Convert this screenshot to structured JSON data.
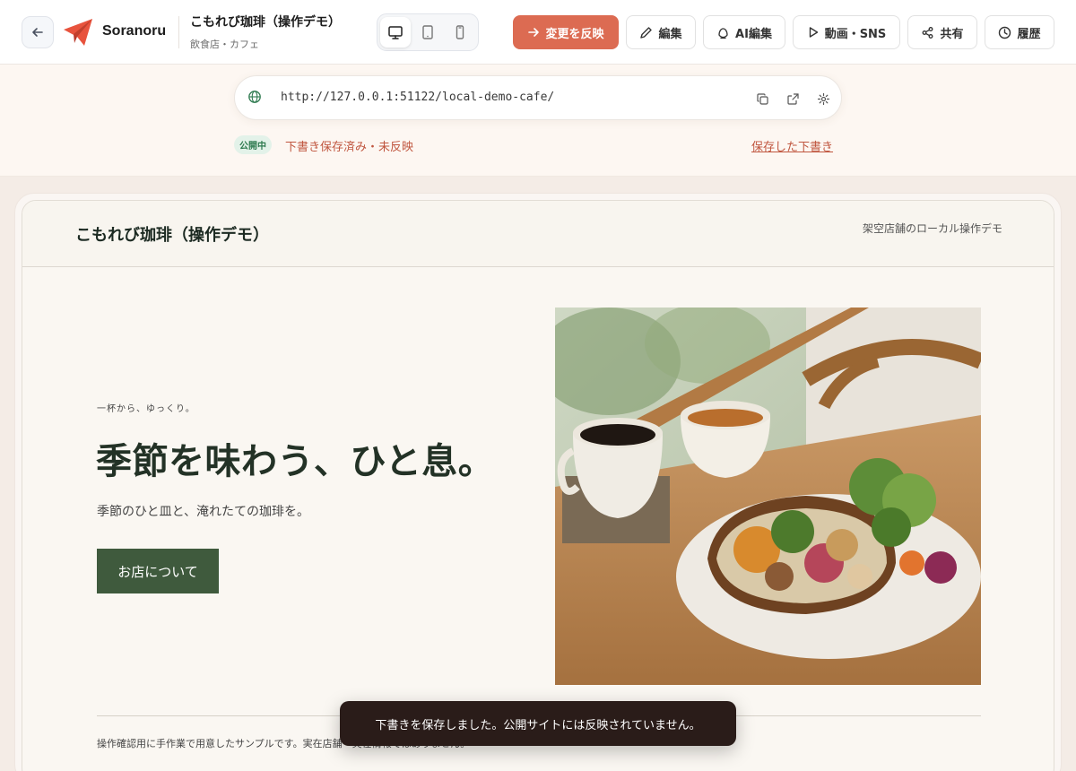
{
  "header": {
    "brand": "Soranoru",
    "site_title": "こもれび珈琲（操作デモ）",
    "site_category": "飲食店・カフェ",
    "actions": {
      "publish": "変更を反映",
      "edit": "編集",
      "ai_edit": "AI編集",
      "video_sns": "動画・SNS",
      "share": "共有",
      "history": "履歴"
    },
    "accent_color": "#dc6b52"
  },
  "preview": {
    "url": "http://127.0.0.1:51122/local-demo-cafe/",
    "status_badge": "公開中",
    "status_text": "下書き保存済み・未反映",
    "saved_draft_link": "保存した下書き"
  },
  "site": {
    "logo_text": "こもれび珈琲（操作デモ）",
    "tagline": "架空店舗のローカル操作デモ",
    "hero": {
      "eyebrow": "一杯から、ゆっくり。",
      "title": "季節を味わう、ひと息。",
      "description": "季節のひと皿と、淹れたての珈琲を。",
      "cta": "お店について"
    },
    "note": "操作確認用に手作業で用意したサンプルです。実在店舗・実在情報ではありません。",
    "brand_color": "#3f5a3d"
  },
  "toast": {
    "message": "下書きを保存しました。公開サイトには反映されていません。"
  }
}
